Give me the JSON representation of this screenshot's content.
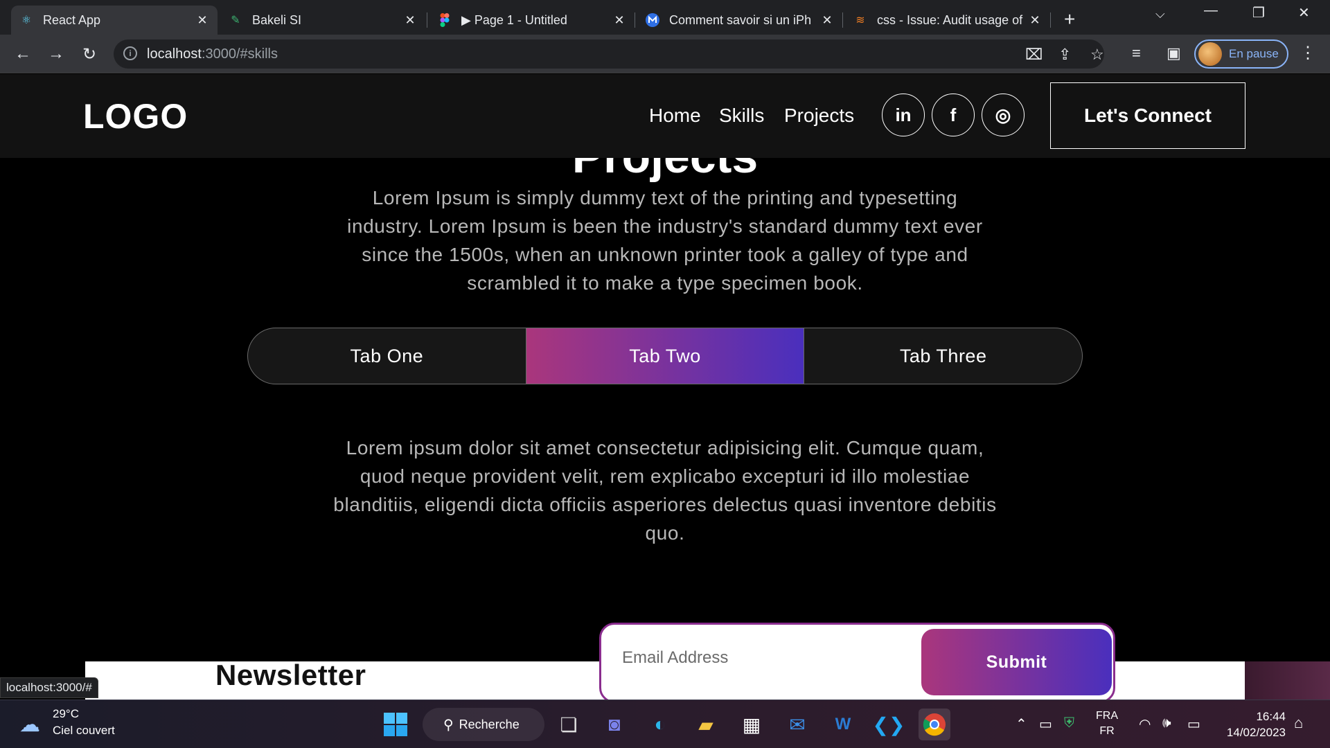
{
  "browser": {
    "tabs": [
      {
        "title": "React App",
        "favicon": "react-icon",
        "active": true
      },
      {
        "title": "Bakeli SI",
        "favicon": "bakeli-icon",
        "active": false
      },
      {
        "title": "▶ Page 1 - Untitled",
        "favicon": "figma-icon",
        "active": false
      },
      {
        "title": "Comment savoir si un iPh",
        "favicon": "malwarebytes-icon",
        "active": false
      },
      {
        "title": "css - Issue: Audit usage of",
        "favicon": "stackoverflow-icon",
        "active": false
      }
    ],
    "url_host": "localhost",
    "url_path": ":3000/#skills",
    "profile_label": "En pause",
    "status_url": "localhost:3000/#"
  },
  "site": {
    "logo": "LOGO",
    "nav": [
      "Home",
      "Skills",
      "Projects"
    ],
    "social": [
      "in",
      "f",
      "◎"
    ],
    "connect_label": "Let's Connect",
    "section_heading": "Projects",
    "intro": "Lorem Ipsum is simply dummy text of the printing and typesetting industry. Lorem Ipsum is been the industry's standard dummy text ever since the 1500s, when an unknown printer took a galley of type and scrambled it to make a type specimen book.",
    "tabs": [
      {
        "label": "Tab One",
        "active": false
      },
      {
        "label": "Tab Two",
        "active": true
      },
      {
        "label": "Tab Three",
        "active": false
      }
    ],
    "tab_text": "Lorem ipsum dolor sit amet consectetur adipisicing elit. Cumque quam, quod neque provident velit, rem explicabo excepturi id illo molestiae blanditiis, eligendi dicta officiis asperiores delectus quasi inventore debitis quo.",
    "newsletter_title": "Newsletter",
    "email_placeholder": "Email Address",
    "submit_label": "Submit",
    "accent_gradient": [
      "#aa367c",
      "#4a2fbd"
    ]
  },
  "taskbar": {
    "weather_temp": "29°C",
    "weather_desc": "Ciel couvert",
    "search_label": "Recherche",
    "lang_top": "FRA",
    "lang_bottom": "FR",
    "time": "16:44",
    "date": "14/02/2023"
  }
}
